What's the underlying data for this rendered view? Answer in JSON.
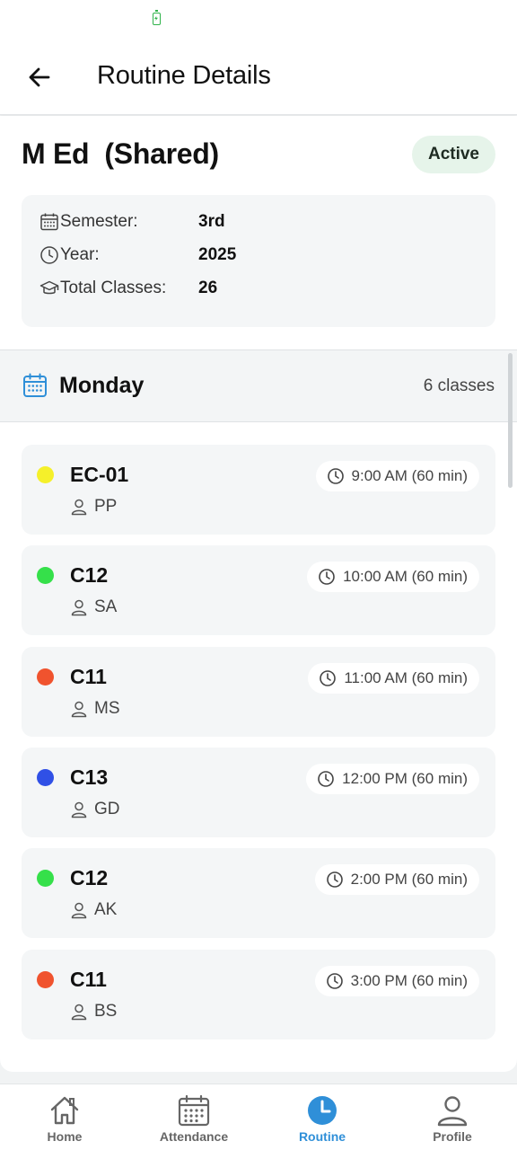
{
  "app_bar": {
    "title": "Routine Details"
  },
  "routine": {
    "name": "M Ed  (Shared)",
    "status": "Active",
    "details": [
      {
        "icon": "calendar-icon",
        "label": "Semester:",
        "value": "3rd"
      },
      {
        "icon": "clock-icon",
        "label": "Year:",
        "value": "2025"
      },
      {
        "icon": "graduation-cap-icon",
        "label": "Total Classes:",
        "value": "26"
      }
    ]
  },
  "day": {
    "name": "Monday",
    "count": "6 classes",
    "icon": "calendar-icon"
  },
  "classes": [
    {
      "code": "EC-01",
      "teacher": "PP",
      "time": "9:00 AM (60 min)",
      "color": "#f5f02a"
    },
    {
      "code": "C12",
      "teacher": "SA",
      "time": "10:00 AM (60 min)",
      "color": "#35e04a"
    },
    {
      "code": "C11",
      "teacher": "MS",
      "time": "11:00 AM (60 min)",
      "color": "#f0532e"
    },
    {
      "code": "C13",
      "teacher": "GD",
      "time": "12:00 PM (60 min)",
      "color": "#3050e6"
    },
    {
      "code": "C12",
      "teacher": "AK",
      "time": "2:00 PM (60 min)",
      "color": "#35e04a"
    },
    {
      "code": "C11",
      "teacher": "BS",
      "time": "3:00 PM (60 min)",
      "color": "#f0532e"
    }
  ],
  "nav": {
    "items": [
      {
        "label": "Home",
        "icon": "home-icon"
      },
      {
        "label": "Attendance",
        "icon": "calendar-icon"
      },
      {
        "label": "Routine",
        "icon": "clock-icon",
        "active": true
      },
      {
        "label": "Profile",
        "icon": "person-icon"
      }
    ]
  },
  "colors": {
    "accent": "#2f8fd8",
    "active_badge_bg": "#e6f4ea",
    "battery": "#2fb34a"
  }
}
